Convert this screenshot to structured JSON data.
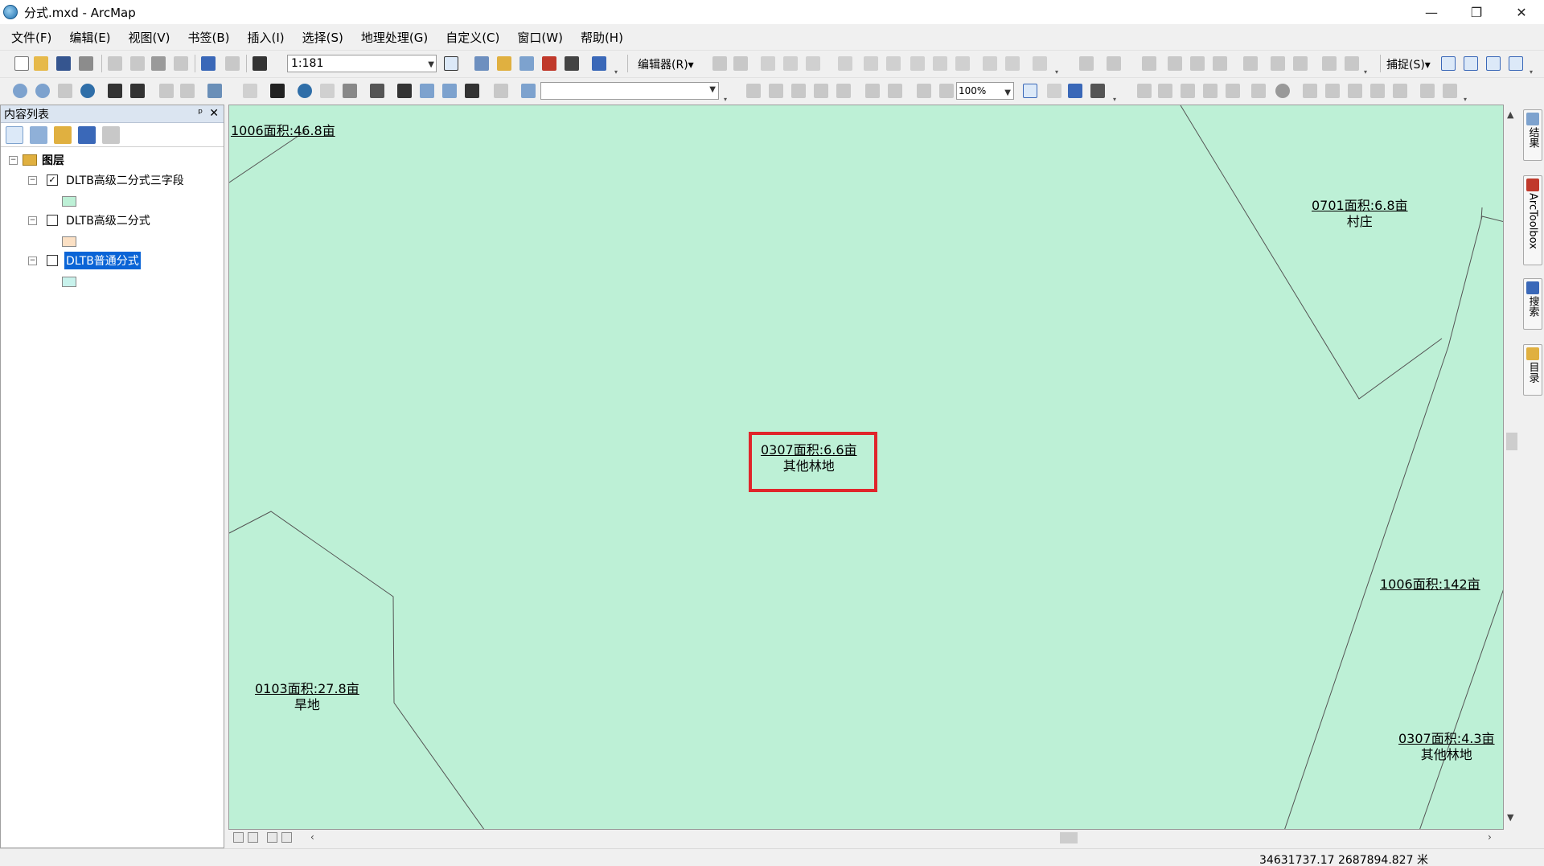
{
  "window": {
    "title": "分式.mxd - ArcMap",
    "minimize": "—",
    "restore": "❐",
    "close": "✕"
  },
  "menu": [
    "文件(F)",
    "编辑(E)",
    "视图(V)",
    "书签(B)",
    "插入(I)",
    "选择(S)",
    "地理处理(G)",
    "自定义(C)",
    "窗口(W)",
    "帮助(H)"
  ],
  "toolbar": {
    "scale": "1:181",
    "editor_label": "编辑器(R)▾",
    "snapping_label": "捕捉(S)▾",
    "zoom_percent": "100%"
  },
  "toc": {
    "title": "内容列表",
    "pin": "ᵖ",
    "close": "✕",
    "root_label": "图层",
    "layers": [
      {
        "name": "DLTB高级二分式三字段",
        "checked": true,
        "swatch_color": "#bdf0d6"
      },
      {
        "name": "DLTB高级二分式",
        "checked": false,
        "swatch_color": "#fbe0c4"
      },
      {
        "name": "DLTB普通分式",
        "checked": false,
        "selected": true,
        "swatch_color": "#c8f2ec"
      }
    ]
  },
  "map": {
    "fill_color": "#bdf0d6",
    "highlight_color": "#e0252b",
    "labels": [
      {
        "code": "1006面积:46.8亩",
        "name": ""
      },
      {
        "code": "0701面积:6.8亩",
        "name": "村庄"
      },
      {
        "code": "0307面积:6.6亩",
        "name": "其他林地"
      },
      {
        "code": "1006面积:142亩",
        "name": ""
      },
      {
        "code": "0103面积:27.8亩",
        "name": "旱地"
      },
      {
        "code": "0307面积:4.3亩",
        "name": "其他林地"
      }
    ]
  },
  "right_dock": [
    "结果",
    "ArcToolbox",
    "搜索",
    "目录"
  ],
  "status": {
    "coordinates": "34631737.17  2687894.827 米"
  }
}
